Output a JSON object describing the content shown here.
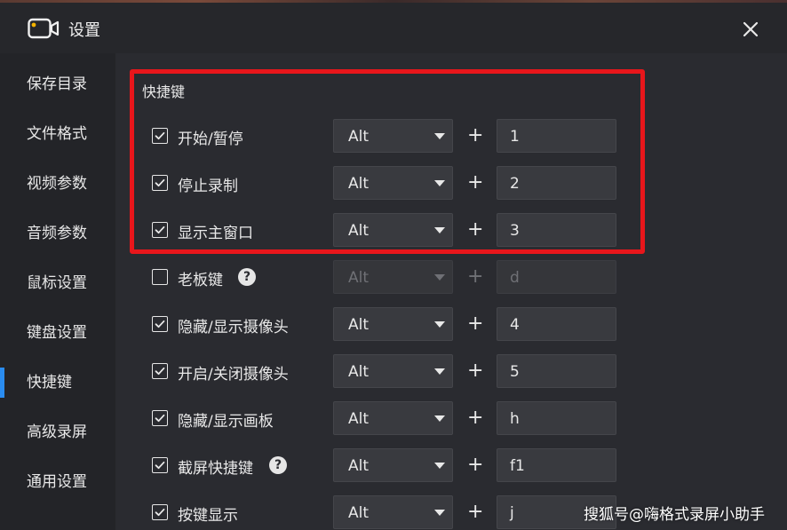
{
  "window": {
    "title": "设置",
    "app_icon": "video-camera-icon",
    "close_icon": "close-icon"
  },
  "sidebar": {
    "items": [
      {
        "label": "保存目录",
        "active": false
      },
      {
        "label": "文件格式",
        "active": false
      },
      {
        "label": "视频参数",
        "active": false
      },
      {
        "label": "音频参数",
        "active": false
      },
      {
        "label": "鼠标设置",
        "active": false
      },
      {
        "label": "键盘设置",
        "active": false
      },
      {
        "label": "快捷键",
        "active": true
      },
      {
        "label": "高级录屏",
        "active": false
      },
      {
        "label": "通用设置",
        "active": false
      }
    ],
    "active_color": "#2a8cf0"
  },
  "main": {
    "section_title": "快捷键",
    "highlight_color": "#e8161b",
    "plus_sign": "+",
    "shortcuts": [
      {
        "label": "开始/暂停",
        "checked": true,
        "modifier": "Alt",
        "key": "1",
        "help": false,
        "enabled": true
      },
      {
        "label": "停止录制",
        "checked": true,
        "modifier": "Alt",
        "key": "2",
        "help": false,
        "enabled": true
      },
      {
        "label": "显示主窗口",
        "checked": true,
        "modifier": "Alt",
        "key": "3",
        "help": false,
        "enabled": true
      },
      {
        "label": "老板键",
        "checked": false,
        "modifier": "Alt",
        "key": "d",
        "help": true,
        "enabled": false
      },
      {
        "label": "隐藏/显示摄像头",
        "checked": true,
        "modifier": "Alt",
        "key": "4",
        "help": false,
        "enabled": true
      },
      {
        "label": "开启/关闭摄像头",
        "checked": true,
        "modifier": "Alt",
        "key": "5",
        "help": false,
        "enabled": true
      },
      {
        "label": "隐藏/显示画板",
        "checked": true,
        "modifier": "Alt",
        "key": "h",
        "help": false,
        "enabled": true
      },
      {
        "label": "截屏快捷键",
        "checked": true,
        "modifier": "Alt",
        "key": "f1",
        "help": true,
        "enabled": true
      },
      {
        "label": "按键显示",
        "checked": true,
        "modifier": "Alt",
        "key": "j",
        "help": false,
        "enabled": true
      }
    ]
  },
  "watermark": "搜狐号@嗨格式录屏小助手"
}
